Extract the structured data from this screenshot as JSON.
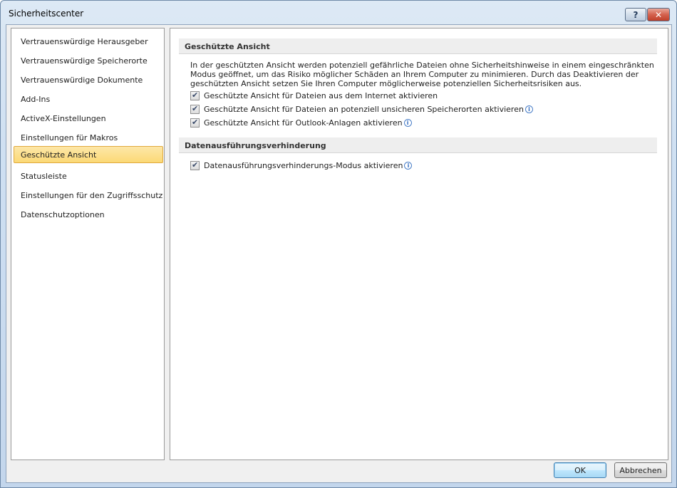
{
  "window": {
    "title": "Sicherheitscenter",
    "help_label": "?",
    "close_label": "✕"
  },
  "sidebar": {
    "items": [
      {
        "label": "Vertrauenswürdige Herausgeber"
      },
      {
        "label": "Vertrauenswürdige Speicherorte"
      },
      {
        "label": "Vertrauenswürdige Dokumente"
      },
      {
        "label": "Add-Ins"
      },
      {
        "label": "ActiveX-Einstellungen"
      },
      {
        "label": "Einstellungen für Makros"
      },
      {
        "label": "Geschützte Ansicht",
        "selected": true
      },
      {
        "label": "Statusleiste"
      },
      {
        "label": "Einstellungen für den Zugriffsschutz"
      },
      {
        "label": "Datenschutzoptionen"
      }
    ]
  },
  "protected_view": {
    "header": "Geschützte Ansicht",
    "description": "In der geschützten Ansicht werden potenziell gefährliche Dateien ohne Sicherheitshinweise in einem eingeschränkten Modus geöffnet, um das Risiko möglicher Schäden an Ihrem Computer zu minimieren. Durch das Deaktivieren der geschützten Ansicht setzen Sie Ihren Computer möglicherweise potenziellen Sicherheitsrisiken aus.",
    "options": [
      {
        "label": "Geschützte Ansicht für Dateien aus dem Internet aktivieren",
        "checked": true,
        "info": false
      },
      {
        "label": "Geschützte Ansicht für Dateien an potenziell unsicheren Speicherorten aktivieren",
        "checked": true,
        "info": true
      },
      {
        "label": "Geschützte Ansicht für Outlook-Anlagen aktivieren",
        "checked": true,
        "info": true
      }
    ]
  },
  "dep": {
    "header": "Datenausführungsverhinderung",
    "options": [
      {
        "label": "Datenausführungsverhinderungs-Modus aktivieren",
        "checked": true,
        "info": true
      }
    ]
  },
  "footer": {
    "ok_label": "OK",
    "cancel_label": "Abbrechen"
  },
  "icons": {
    "info": "i"
  },
  "colors": {
    "selection_bg": "#fbd976",
    "selection_border": "#e0a93c",
    "section_header_bg": "#eeeeee",
    "close_button": "#c0402a"
  }
}
